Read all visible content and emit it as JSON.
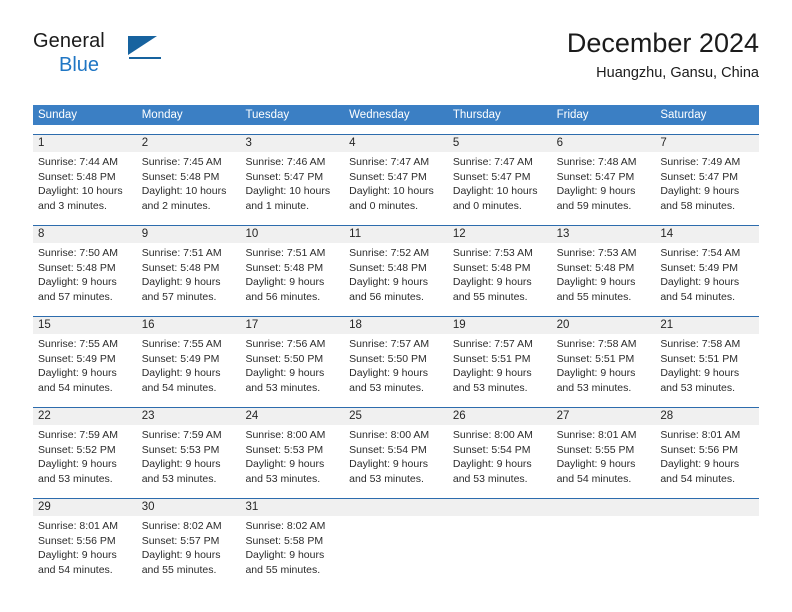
{
  "brand": {
    "name_top": "General",
    "name_bottom": "Blue",
    "logo_icon": "triangle-flag-icon",
    "color_primary": "#17639f",
    "color_blue_text": "#1f76c4"
  },
  "header": {
    "title": "December 2024",
    "subtitle": "Huangzhu, Gansu, China"
  },
  "theme": {
    "header_blue": "#3b7fc4",
    "row_border_blue": "#2d6cad",
    "date_band_gray": "#f0f0f0",
    "text_color": "#2b2b2b"
  },
  "weekdays": [
    "Sunday",
    "Monday",
    "Tuesday",
    "Wednesday",
    "Thursday",
    "Friday",
    "Saturday"
  ],
  "weeks": [
    {
      "days": [
        {
          "num": "1",
          "sunrise": "Sunrise: 7:44 AM",
          "sunset": "Sunset: 5:48 PM",
          "daylight1": "Daylight: 10 hours",
          "daylight2": "and 3 minutes."
        },
        {
          "num": "2",
          "sunrise": "Sunrise: 7:45 AM",
          "sunset": "Sunset: 5:48 PM",
          "daylight1": "Daylight: 10 hours",
          "daylight2": "and 2 minutes."
        },
        {
          "num": "3",
          "sunrise": "Sunrise: 7:46 AM",
          "sunset": "Sunset: 5:47 PM",
          "daylight1": "Daylight: 10 hours",
          "daylight2": "and 1 minute."
        },
        {
          "num": "4",
          "sunrise": "Sunrise: 7:47 AM",
          "sunset": "Sunset: 5:47 PM",
          "daylight1": "Daylight: 10 hours",
          "daylight2": "and 0 minutes."
        },
        {
          "num": "5",
          "sunrise": "Sunrise: 7:47 AM",
          "sunset": "Sunset: 5:47 PM",
          "daylight1": "Daylight: 10 hours",
          "daylight2": "and 0 minutes."
        },
        {
          "num": "6",
          "sunrise": "Sunrise: 7:48 AM",
          "sunset": "Sunset: 5:47 PM",
          "daylight1": "Daylight: 9 hours",
          "daylight2": "and 59 minutes."
        },
        {
          "num": "7",
          "sunrise": "Sunrise: 7:49 AM",
          "sunset": "Sunset: 5:47 PM",
          "daylight1": "Daylight: 9 hours",
          "daylight2": "and 58 minutes."
        }
      ]
    },
    {
      "days": [
        {
          "num": "8",
          "sunrise": "Sunrise: 7:50 AM",
          "sunset": "Sunset: 5:48 PM",
          "daylight1": "Daylight: 9 hours",
          "daylight2": "and 57 minutes."
        },
        {
          "num": "9",
          "sunrise": "Sunrise: 7:51 AM",
          "sunset": "Sunset: 5:48 PM",
          "daylight1": "Daylight: 9 hours",
          "daylight2": "and 57 minutes."
        },
        {
          "num": "10",
          "sunrise": "Sunrise: 7:51 AM",
          "sunset": "Sunset: 5:48 PM",
          "daylight1": "Daylight: 9 hours",
          "daylight2": "and 56 minutes."
        },
        {
          "num": "11",
          "sunrise": "Sunrise: 7:52 AM",
          "sunset": "Sunset: 5:48 PM",
          "daylight1": "Daylight: 9 hours",
          "daylight2": "and 56 minutes."
        },
        {
          "num": "12",
          "sunrise": "Sunrise: 7:53 AM",
          "sunset": "Sunset: 5:48 PM",
          "daylight1": "Daylight: 9 hours",
          "daylight2": "and 55 minutes."
        },
        {
          "num": "13",
          "sunrise": "Sunrise: 7:53 AM",
          "sunset": "Sunset: 5:48 PM",
          "daylight1": "Daylight: 9 hours",
          "daylight2": "and 55 minutes."
        },
        {
          "num": "14",
          "sunrise": "Sunrise: 7:54 AM",
          "sunset": "Sunset: 5:49 PM",
          "daylight1": "Daylight: 9 hours",
          "daylight2": "and 54 minutes."
        }
      ]
    },
    {
      "days": [
        {
          "num": "15",
          "sunrise": "Sunrise: 7:55 AM",
          "sunset": "Sunset: 5:49 PM",
          "daylight1": "Daylight: 9 hours",
          "daylight2": "and 54 minutes."
        },
        {
          "num": "16",
          "sunrise": "Sunrise: 7:55 AM",
          "sunset": "Sunset: 5:49 PM",
          "daylight1": "Daylight: 9 hours",
          "daylight2": "and 54 minutes."
        },
        {
          "num": "17",
          "sunrise": "Sunrise: 7:56 AM",
          "sunset": "Sunset: 5:50 PM",
          "daylight1": "Daylight: 9 hours",
          "daylight2": "and 53 minutes."
        },
        {
          "num": "18",
          "sunrise": "Sunrise: 7:57 AM",
          "sunset": "Sunset: 5:50 PM",
          "daylight1": "Daylight: 9 hours",
          "daylight2": "and 53 minutes."
        },
        {
          "num": "19",
          "sunrise": "Sunrise: 7:57 AM",
          "sunset": "Sunset: 5:51 PM",
          "daylight1": "Daylight: 9 hours",
          "daylight2": "and 53 minutes."
        },
        {
          "num": "20",
          "sunrise": "Sunrise: 7:58 AM",
          "sunset": "Sunset: 5:51 PM",
          "daylight1": "Daylight: 9 hours",
          "daylight2": "and 53 minutes."
        },
        {
          "num": "21",
          "sunrise": "Sunrise: 7:58 AM",
          "sunset": "Sunset: 5:51 PM",
          "daylight1": "Daylight: 9 hours",
          "daylight2": "and 53 minutes."
        }
      ]
    },
    {
      "days": [
        {
          "num": "22",
          "sunrise": "Sunrise: 7:59 AM",
          "sunset": "Sunset: 5:52 PM",
          "daylight1": "Daylight: 9 hours",
          "daylight2": "and 53 minutes."
        },
        {
          "num": "23",
          "sunrise": "Sunrise: 7:59 AM",
          "sunset": "Sunset: 5:53 PM",
          "daylight1": "Daylight: 9 hours",
          "daylight2": "and 53 minutes."
        },
        {
          "num": "24",
          "sunrise": "Sunrise: 8:00 AM",
          "sunset": "Sunset: 5:53 PM",
          "daylight1": "Daylight: 9 hours",
          "daylight2": "and 53 minutes."
        },
        {
          "num": "25",
          "sunrise": "Sunrise: 8:00 AM",
          "sunset": "Sunset: 5:54 PM",
          "daylight1": "Daylight: 9 hours",
          "daylight2": "and 53 minutes."
        },
        {
          "num": "26",
          "sunrise": "Sunrise: 8:00 AM",
          "sunset": "Sunset: 5:54 PM",
          "daylight1": "Daylight: 9 hours",
          "daylight2": "and 53 minutes."
        },
        {
          "num": "27",
          "sunrise": "Sunrise: 8:01 AM",
          "sunset": "Sunset: 5:55 PM",
          "daylight1": "Daylight: 9 hours",
          "daylight2": "and 54 minutes."
        },
        {
          "num": "28",
          "sunrise": "Sunrise: 8:01 AM",
          "sunset": "Sunset: 5:56 PM",
          "daylight1": "Daylight: 9 hours",
          "daylight2": "and 54 minutes."
        }
      ]
    },
    {
      "days": [
        {
          "num": "29",
          "sunrise": "Sunrise: 8:01 AM",
          "sunset": "Sunset: 5:56 PM",
          "daylight1": "Daylight: 9 hours",
          "daylight2": "and 54 minutes."
        },
        {
          "num": "30",
          "sunrise": "Sunrise: 8:02 AM",
          "sunset": "Sunset: 5:57 PM",
          "daylight1": "Daylight: 9 hours",
          "daylight2": "and 55 minutes."
        },
        {
          "num": "31",
          "sunrise": "Sunrise: 8:02 AM",
          "sunset": "Sunset: 5:58 PM",
          "daylight1": "Daylight: 9 hours",
          "daylight2": "and 55 minutes."
        },
        {
          "num": "",
          "sunrise": "",
          "sunset": "",
          "daylight1": "",
          "daylight2": ""
        },
        {
          "num": "",
          "sunrise": "",
          "sunset": "",
          "daylight1": "",
          "daylight2": ""
        },
        {
          "num": "",
          "sunrise": "",
          "sunset": "",
          "daylight1": "",
          "daylight2": ""
        },
        {
          "num": "",
          "sunrise": "",
          "sunset": "",
          "daylight1": "",
          "daylight2": ""
        }
      ]
    }
  ]
}
